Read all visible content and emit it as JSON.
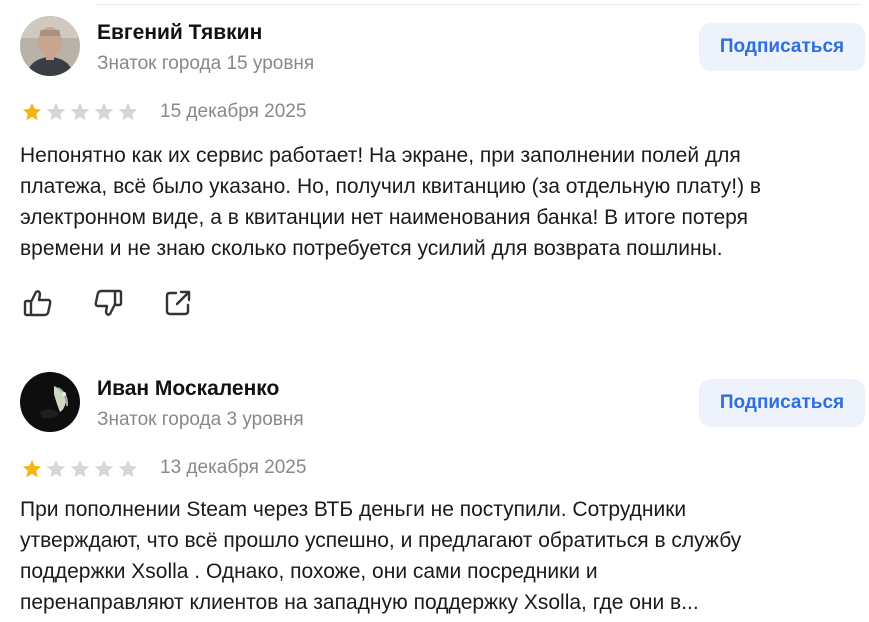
{
  "reviews": [
    {
      "author_name": "Евгений Тявкин",
      "author_level": "Знаток города 15 уровня",
      "subscribe_label": "Подписаться",
      "rating": 1,
      "rating_max": 5,
      "date": "15 декабря 2025",
      "text": "Непонятно как их сервис работает! На экране, при заполнении полей для\nплатежа, всё было указано. Но, получил квитанцию (за отдельную плату!) в\nэлектронном виде, а в квитанции нет наименования банка! В итоге потеря\nвремени и не знаю сколько потребуется усилий для возврата пошлины.",
      "actions": [
        "thumbs-up-icon",
        "thumbs-down-icon",
        "share-icon"
      ]
    },
    {
      "author_name": "Иван Москаленко",
      "author_level": "Знаток города 3 уровня",
      "subscribe_label": "Подписаться",
      "rating": 1,
      "rating_max": 5,
      "date": "13 декабря 2025",
      "text": "При пополнении Steam через ВТБ деньги не поступили. Сотрудники\nутверждают, что всё прошло успешно, и предлагают обратиться в службу\nподдержки Xsolla . Однако, похоже, они сами посредники и\nперенаправляют клиентов на западную поддержку Xsolla, где они в..."
    }
  ],
  "colors": {
    "star_filled": "#f7b512",
    "star_empty": "#d6d6d6",
    "subscribe_bg": "#eef3fb",
    "subscribe_text": "#2d6ee0",
    "muted_text": "#888888"
  }
}
